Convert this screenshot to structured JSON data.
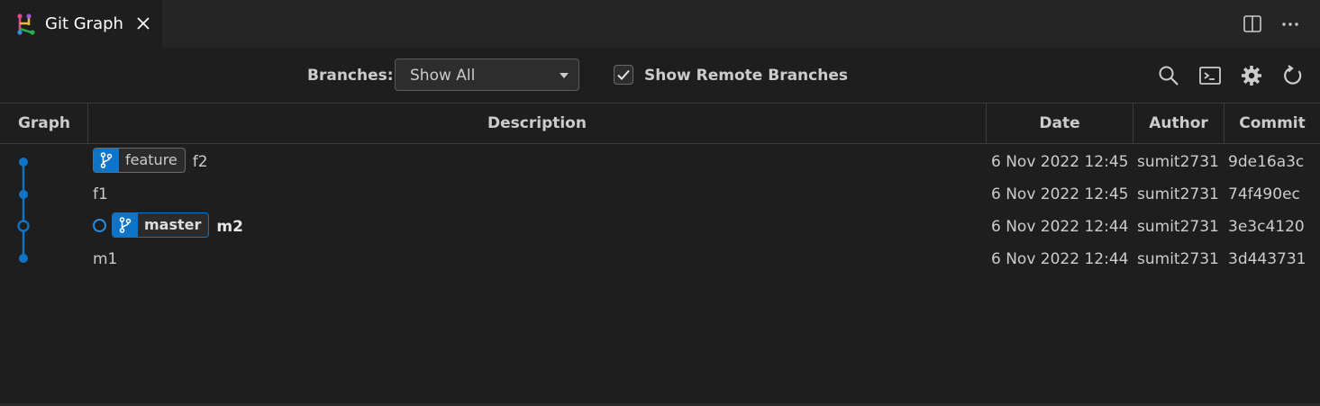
{
  "tab": {
    "title": "Git Graph",
    "icon": "git-graph-icon"
  },
  "toolbar": {
    "branches_label": "Branches:",
    "branches_value": "Show All",
    "show_remote_label": "Show Remote Branches",
    "show_remote_checked": true
  },
  "columns": {
    "graph": "Graph",
    "description": "Description",
    "date": "Date",
    "author": "Author",
    "commit": "Commit"
  },
  "commits": [
    {
      "ref": "feature",
      "message": "f2",
      "date": "6 Nov 2022 12:45",
      "author": "sumit2731",
      "hash": "9de16a3c"
    },
    {
      "ref": "",
      "message": "f1",
      "date": "6 Nov 2022 12:45",
      "author": "sumit2731",
      "hash": "74f490ec"
    },
    {
      "ref": "master",
      "message": "m2",
      "head": true,
      "date": "6 Nov 2022 12:44",
      "author": "sumit2731",
      "hash": "3e3c4120"
    },
    {
      "ref": "",
      "message": "m1",
      "date": "6 Nov 2022 12:44",
      "author": "sumit2731",
      "hash": "3d443731"
    }
  ],
  "colors": {
    "graph_line": "#0e74c8",
    "accent": "#0e74c8",
    "background": "#1e1e1e"
  }
}
